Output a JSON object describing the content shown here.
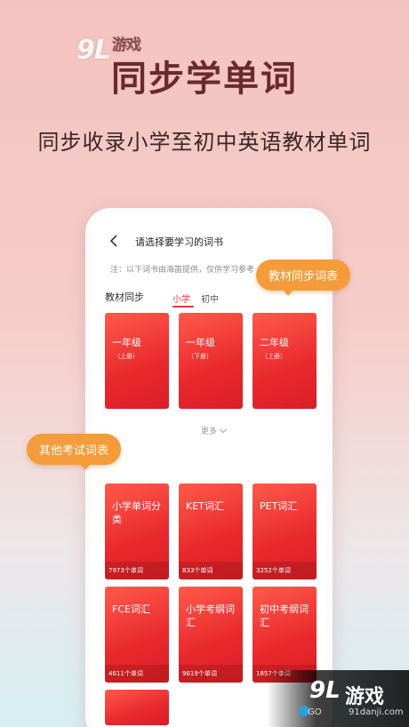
{
  "top_logo": {
    "brand": "9L",
    "brand_cn": "游戏"
  },
  "headline": "同步学单词",
  "subheadline": "同步收录小学至初中英语教材单词",
  "phone": {
    "nav_title": "请选择要学习的词书",
    "notice": "注：以下词书由海笛提供，仅供学习参考",
    "section_label": "教材同步",
    "tabs": [
      {
        "label": "小学",
        "active": true
      },
      {
        "label": "初中",
        "active": false
      }
    ],
    "sync_books": [
      {
        "title": "一年级",
        "sub": "（上册）"
      },
      {
        "title": "一年级",
        "sub": "（下册）"
      },
      {
        "title": "二年级",
        "sub": "（上册）"
      }
    ],
    "more_label": "更多",
    "exam_books": [
      {
        "title": "小学单词分类",
        "count": "7973个单词"
      },
      {
        "title": "KET词汇",
        "count": "833个单词"
      },
      {
        "title": "PET词汇",
        "count": "3252个单词"
      },
      {
        "title": "FCE词汇",
        "count": "4611个单词"
      },
      {
        "title": "小学考纲词汇",
        "count": "9619个单词"
      },
      {
        "title": "初中考纲词汇",
        "count": "1857个单词"
      }
    ]
  },
  "callouts": {
    "sync": "教材同步词表",
    "exam": "其他考试词表"
  },
  "bottom_logo": {
    "brand": "9L",
    "brand_cn": "游戏",
    "site_left": "GO",
    "site_right": "91danji.com"
  },
  "colors": {
    "accent": "#e8383b",
    "callout": "#f59b3a",
    "headline": "#6a2b2a"
  }
}
